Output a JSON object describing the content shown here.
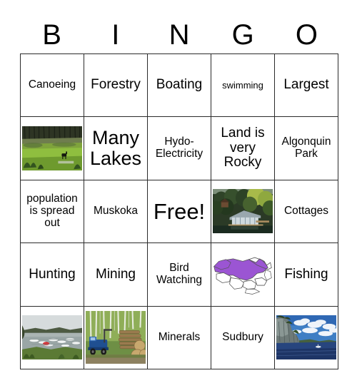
{
  "card": {
    "type": "bingo-card",
    "header_letters": [
      "B",
      "I",
      "N",
      "G",
      "O"
    ],
    "grid_size": "5x5",
    "border_color": "#2b2b2b",
    "background_color": "#ffffff"
  },
  "cells": [
    {
      "id": "r1c1",
      "kind": "text",
      "text": "Canoeing",
      "size": "normal"
    },
    {
      "id": "r1c2",
      "kind": "text",
      "text": "Forestry",
      "size": "med"
    },
    {
      "id": "r1c3",
      "kind": "text",
      "text": "Boating",
      "size": "med"
    },
    {
      "id": "r1c4",
      "kind": "text",
      "text": "swimming",
      "size": "small"
    },
    {
      "id": "r1c5",
      "kind": "text",
      "text": "Largest",
      "size": "med"
    },
    {
      "id": "r2c1",
      "kind": "image",
      "image": "wetland-moose-photo",
      "alt": "Wetland bog with moose and burnt trees"
    },
    {
      "id": "r2c2",
      "kind": "text",
      "text": "Many Lakes",
      "size": "large"
    },
    {
      "id": "r2c3",
      "kind": "text",
      "text": "Hydo-Electricity",
      "size": "normal"
    },
    {
      "id": "r2c4",
      "kind": "text",
      "text": "Land is very Rocky",
      "size": "med"
    },
    {
      "id": "r2c5",
      "kind": "text",
      "text": "Algonquin Park",
      "size": "normal"
    },
    {
      "id": "r3c1",
      "kind": "text",
      "text": "population is spread out",
      "size": "normal"
    },
    {
      "id": "r3c2",
      "kind": "text",
      "text": "Muskoka",
      "size": "normal"
    },
    {
      "id": "r3c3",
      "kind": "text",
      "text": "Free!",
      "size": "xlarge"
    },
    {
      "id": "r3c4",
      "kind": "image",
      "image": "boathouse-cottage-photo",
      "alt": "Lakeside boathouse cottage among trees"
    },
    {
      "id": "r3c5",
      "kind": "text",
      "text": "Cottages",
      "size": "normal"
    },
    {
      "id": "r4c1",
      "kind": "text",
      "text": "Hunting",
      "size": "med"
    },
    {
      "id": "r4c2",
      "kind": "text",
      "text": "Mining",
      "size": "med"
    },
    {
      "id": "r4c3",
      "kind": "text",
      "text": "Bird Watching",
      "size": "normal"
    },
    {
      "id": "r4c4",
      "kind": "image",
      "image": "ontario-map-purple",
      "alt": "Map of Ontario highlighted in purple"
    },
    {
      "id": "r4c5",
      "kind": "text",
      "text": "Fishing",
      "size": "med"
    },
    {
      "id": "r5c1",
      "kind": "image",
      "image": "marina-boats-photo",
      "alt": "Marina with boats on a grey lake"
    },
    {
      "id": "r5c2",
      "kind": "image",
      "image": "logging-truck-photo",
      "alt": "Blue logging truck with stacked logs in forest"
    },
    {
      "id": "r5c3",
      "kind": "text",
      "text": "Minerals",
      "size": "normal"
    },
    {
      "id": "r5c4",
      "kind": "text",
      "text": "Sudbury",
      "size": "normal"
    },
    {
      "id": "r5c5",
      "kind": "image",
      "image": "cliff-shoreline-photo",
      "alt": "Rocky cliffs above blue lake with clouds"
    }
  ],
  "colors": {
    "ontario_purple": "#9B55D3",
    "map_outline": "#555555",
    "grid_line": "#2b2b2b",
    "text": "#000000"
  }
}
